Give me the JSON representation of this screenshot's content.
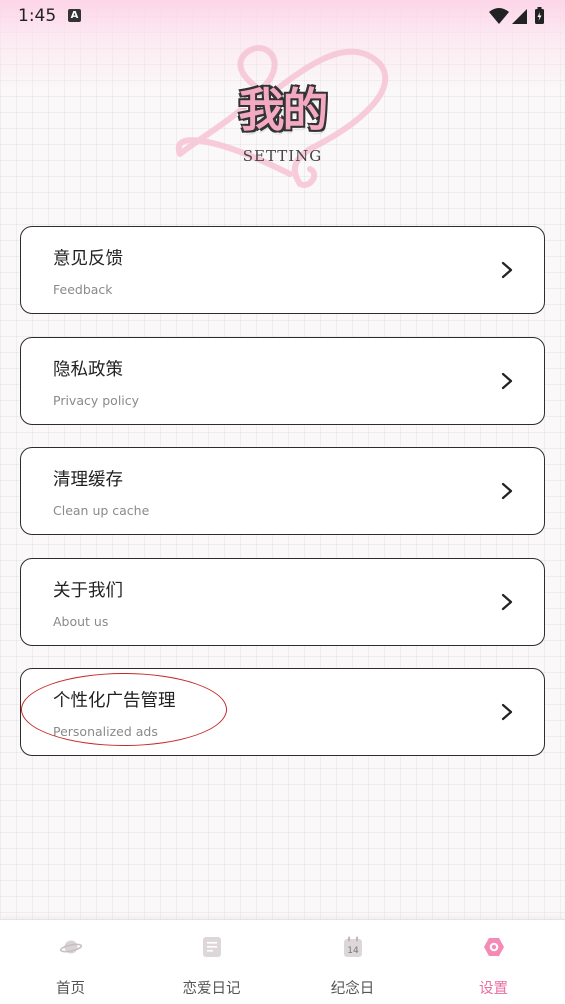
{
  "status_bar": {
    "time": "1:45",
    "notification_letter": "A",
    "icons": [
      "wifi-icon",
      "signal-icon",
      "battery-icon"
    ]
  },
  "header": {
    "title": "我的",
    "subtitle": "SETTING"
  },
  "menu": {
    "items": [
      {
        "title": "意见反馈",
        "subtitle": "Feedback",
        "icon": "chevron-right-icon"
      },
      {
        "title": "隐私政策",
        "subtitle": "Privacy policy",
        "icon": "chevron-right-icon"
      },
      {
        "title": "清理缓存",
        "subtitle": "Clean up cache",
        "icon": "chevron-right-icon"
      },
      {
        "title": "关于我们",
        "subtitle": "About us",
        "icon": "chevron-right-icon"
      },
      {
        "title": "个性化广告管理",
        "subtitle": "Personalized ads",
        "icon": "chevron-right-icon"
      }
    ]
  },
  "tabbar": {
    "tabs": [
      {
        "label": "首页",
        "icon": "planet-icon",
        "active": false
      },
      {
        "label": "恋爱日记",
        "icon": "diary-icon",
        "active": false
      },
      {
        "label": "纪念日",
        "icon": "calendar-icon",
        "active": false,
        "icon_text": "14"
      },
      {
        "label": "设置",
        "icon": "settings-icon",
        "active": true
      }
    ]
  },
  "colors": {
    "accent": "#ea6ea1",
    "annotation": "#c62828",
    "card_border": "#2d2d2d",
    "title_fill": "#f2a9c1"
  }
}
